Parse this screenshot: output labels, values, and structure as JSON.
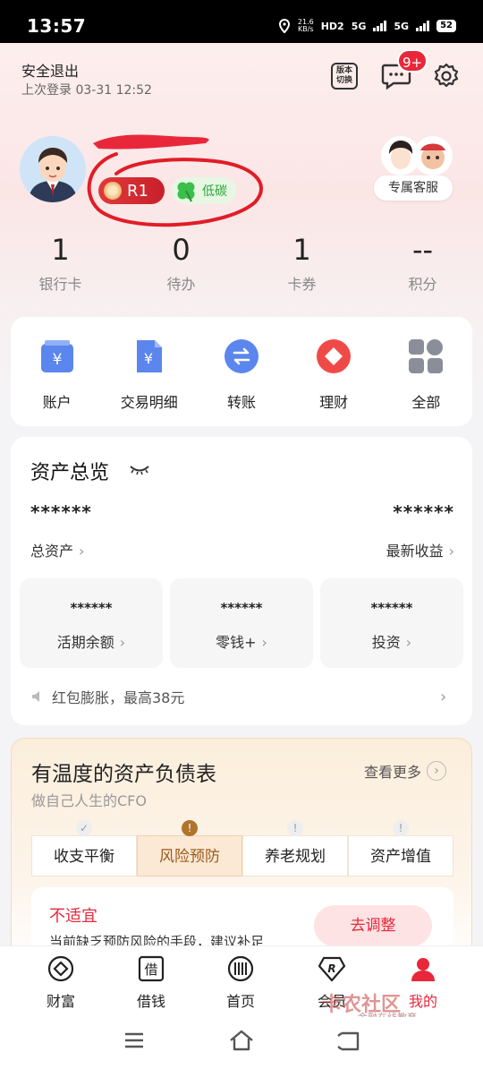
{
  "status": {
    "time": "13:57",
    "net_speed": "21.6",
    "net_unit": "KB/s",
    "hd": "HD2",
    "sig1": "5G",
    "sig2": "5G",
    "battery": "52"
  },
  "header": {
    "logout": "安全退出",
    "last_login": "上次登录 03-31 12:52",
    "version_switch": "版本切换",
    "msg_badge": "9+"
  },
  "profile": {
    "rank_label": "R1",
    "low_carbon": "低碳",
    "service_label": "专属客服"
  },
  "stats": [
    {
      "value": "1",
      "label": "银行卡"
    },
    {
      "value": "0",
      "label": "待办"
    },
    {
      "value": "1",
      "label": "卡券"
    },
    {
      "value": "--",
      "label": "积分"
    }
  ],
  "quick_actions": [
    {
      "label": "账户",
      "icon": "account-icon"
    },
    {
      "label": "交易明细",
      "icon": "transaction-details-icon"
    },
    {
      "label": "转账",
      "icon": "transfer-icon"
    },
    {
      "label": "理财",
      "icon": "wealth-management-icon"
    },
    {
      "label": "全部",
      "icon": "all-services-icon"
    }
  ],
  "assets": {
    "title": "资产总览",
    "total_value": "******",
    "total_label": "总资产",
    "income_value": "******",
    "income_label": "最新收益",
    "mini": [
      {
        "value": "******",
        "label": "活期余额"
      },
      {
        "value": "******",
        "label": "零钱+"
      },
      {
        "value": "******",
        "label": "投资"
      }
    ],
    "notice": "红包膨胀，最高38元"
  },
  "balance_sheet": {
    "title": "有温度的资产负债表",
    "subtitle": "做自己人生的CFO",
    "more": "查看更多",
    "tabs": [
      "收支平衡",
      "风险预防",
      "养老规划",
      "资产增值"
    ],
    "panel_title": "不适宜",
    "panel_desc": "当前缺乏预防风险的手段，建议补足",
    "adjust_btn": "去调整"
  },
  "bottom_nav": [
    {
      "label": "财富",
      "icon": "wealth-icon"
    },
    {
      "label": "借钱",
      "icon": "borrow-icon"
    },
    {
      "label": "首页",
      "icon": "home-icon"
    },
    {
      "label": "会员",
      "icon": "member-icon"
    },
    {
      "label": "我的",
      "icon": "me-icon"
    }
  ],
  "watermark": {
    "main": "卡农社区",
    "sub": "金融在线教育"
  },
  "colors": {
    "accent": "#e8283a",
    "gold": "#9b5a17",
    "green": "#2ea43a"
  }
}
